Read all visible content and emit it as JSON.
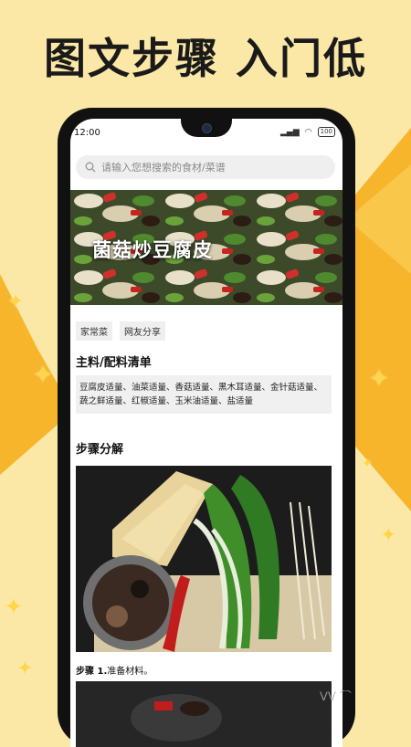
{
  "headline": "图文步骤 入门低",
  "status": {
    "time": "12:00",
    "battery": "100"
  },
  "search": {
    "placeholder": "请输入您想搜索的食材/菜谱"
  },
  "recipe": {
    "title": "菌菇炒豆腐皮"
  },
  "tags": [
    "家常菜",
    "网友分享"
  ],
  "ingredients_section": {
    "title": "主料/配料清单",
    "text": "豆腐皮适量、油菜适量、香菇适量、黑木耳适量、金针菇适量、蔬之鲜适量、红椒适量、玉米油适量、盐适量"
  },
  "steps_section": {
    "title": "步骤分解"
  },
  "steps": [
    {
      "label": "步骤 1.",
      "text": "准备材料。"
    }
  ],
  "colors": {
    "background": "#fbe7a6",
    "accent": "#f7b52c",
    "phone": "#111111"
  }
}
